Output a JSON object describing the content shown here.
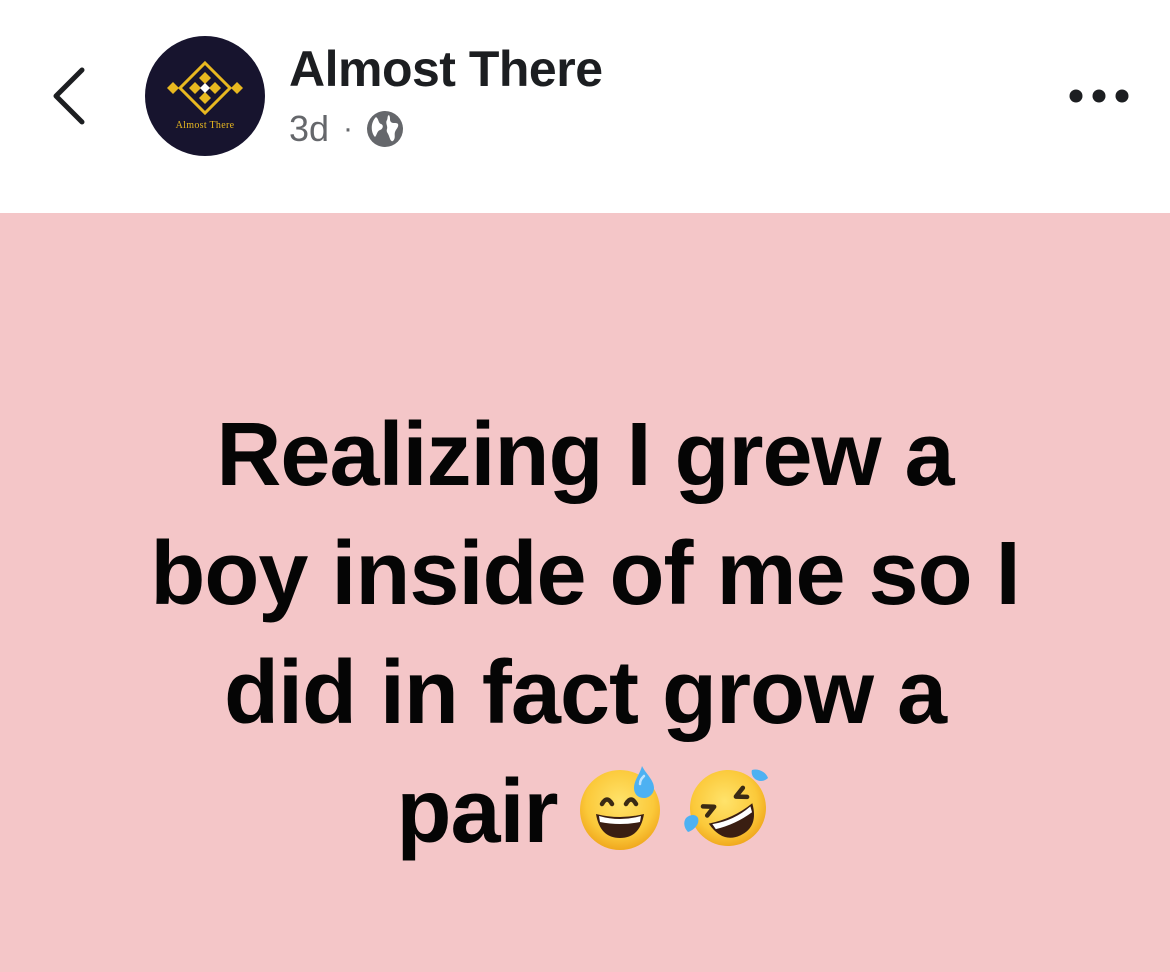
{
  "header": {
    "back_icon": "chevron-left-icon",
    "avatar_logo_text": "Almost There",
    "author_name": "Almost There",
    "timestamp": "3d",
    "separator": "·",
    "audience_icon": "globe-icon",
    "more_icon": "ellipsis-icon"
  },
  "post": {
    "background_color": "#f4c6c8",
    "lines": [
      "Realizing I grew a",
      "boy inside of me so I",
      "did in fact grow a",
      "pair"
    ],
    "emojis": [
      "grinning-face-with-sweat-emoji",
      "rolling-on-floor-laughing-emoji"
    ]
  }
}
